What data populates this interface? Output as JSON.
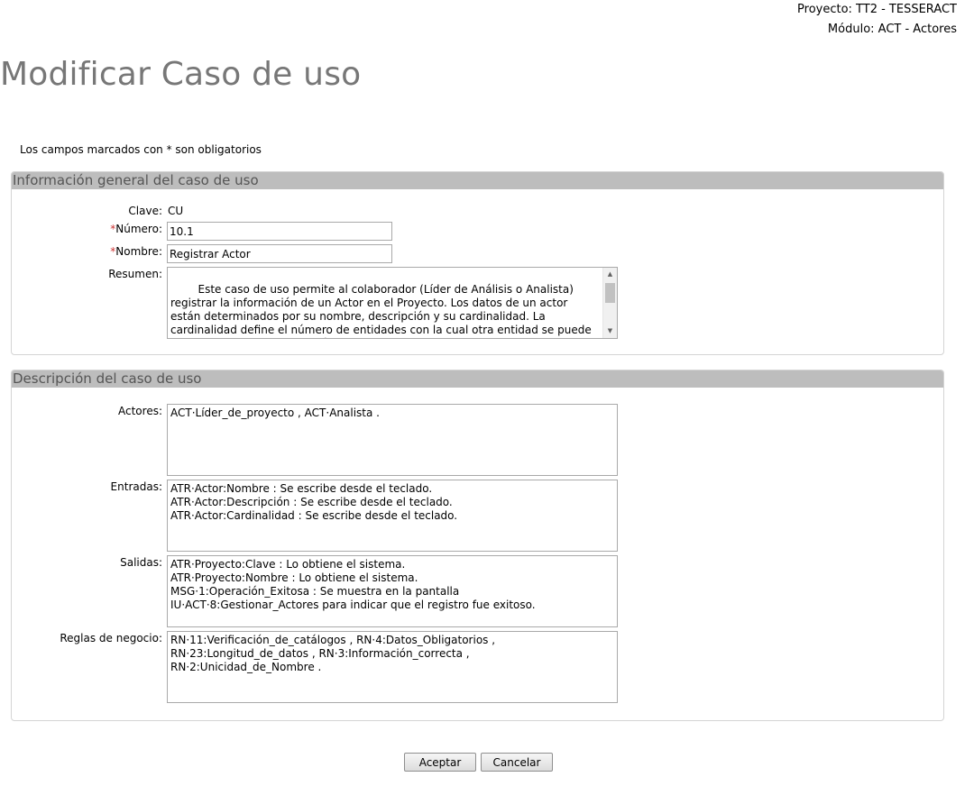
{
  "header": {
    "project": "Proyecto: TT2 - TESSERACT",
    "module": "Módulo: ACT - Actores"
  },
  "page_title": "Modificar Caso de uso",
  "required_note": "Los campos marcados con * son obligatorios",
  "general": {
    "title": "Información general del caso de uso",
    "clave_label": "Clave:",
    "clave_value": "CU",
    "numero_label": "Número:",
    "numero_value": "10.1",
    "nombre_label": "Nombre:",
    "nombre_value": "Registrar Actor",
    "resumen_label": "Resumen:",
    "resumen_value": "Este caso de uso permite al colaborador (Líder de Análisis o Analista) registrar la información de un Actor en el Proyecto. Los datos de un actor están determinados por su nombre, descripción y su cardinalidad. La cardinalidad define el número de entidades con la cual otra entidad se puede asociar mediante una relación binaria.",
    "required_star": "*"
  },
  "description": {
    "title": "Descripción del caso de uso",
    "actores_label": "Actores:",
    "actores_value": "ACT·Líder_de_proyecto , ACT·Analista .",
    "entradas_label": "Entradas:",
    "entradas_value": "ATR·Actor:Nombre : Se escribe desde el teclado.\nATR·Actor:Descripción : Se escribe desde el teclado.\nATR·Actor:Cardinalidad : Se escribe desde el teclado.",
    "salidas_label": "Salidas:",
    "salidas_value": "ATR·Proyecto:Clave : Lo obtiene el sistema.\nATR·Proyecto:Nombre : Lo obtiene el sistema.\nMSG·1:Operación_Exitosa : Se muestra en la pantalla\nIU·ACT·8:Gestionar_Actores para indicar que el registro fue exitoso.",
    "reglas_label": "Reglas de negocio:",
    "reglas_value": "RN·11:Verificación_de_catálogos , RN·4:Datos_Obligatorios ,\nRN·23:Longitud_de_datos , RN·3:Información_correcta ,\nRN·2:Unicidad_de_Nombre ."
  },
  "buttons": {
    "accept": "Aceptar",
    "cancel": "Cancelar"
  },
  "icons": {
    "scroll_up": "triangle-up-icon",
    "scroll_down": "triangle-down-icon"
  }
}
